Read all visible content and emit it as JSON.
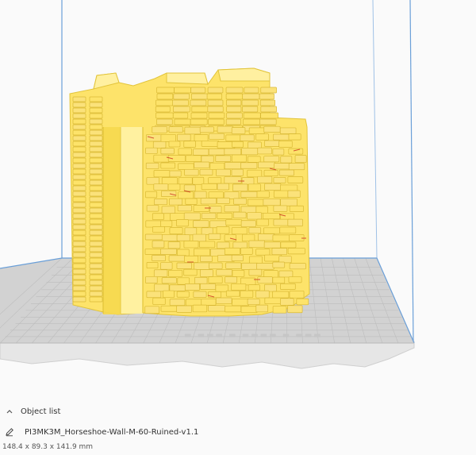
{
  "viewport": {
    "build_plate_color": "#d2d2d2",
    "grid_line_color": "#bdbdbd",
    "volume_edge_color": "#6a9fd8",
    "model_color": "#fde36a",
    "model_shadow_color": "#e2c43a",
    "model_accent_color": "#c8281e"
  },
  "object_list": {
    "chevron_icon": "chevron-up-icon",
    "label": "Object list",
    "edit_icon": "pencil-icon",
    "object_name": "PI3MK3M_Horseshoe-Wall-M-60-Ruined-v1.1",
    "dimensions": "148.4 x 89.3 x 141.9 mm"
  }
}
